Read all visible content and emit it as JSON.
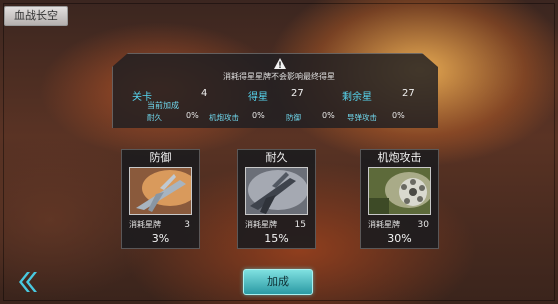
{
  "title_tab": "血战长空",
  "notice": "消耗得星星牌不会影响最终得星",
  "stats": [
    {
      "label": "关卡",
      "value": "4"
    },
    {
      "label": "得星",
      "value": "27"
    },
    {
      "label": "剩余星",
      "value": "27"
    }
  ],
  "current_bonus_label": "当前加成",
  "bonuses": [
    {
      "label": "耐久",
      "value": "0%"
    },
    {
      "label": "机炮攻击",
      "value": "0%"
    },
    {
      "label": "防御",
      "value": "0%"
    },
    {
      "label": "导弹攻击",
      "value": "0%"
    }
  ],
  "cards": [
    {
      "title": "防御",
      "cost_label": "消耗星牌",
      "cost": "3",
      "percent": "3%"
    },
    {
      "title": "耐久",
      "cost_label": "消耗星牌",
      "cost": "15",
      "percent": "15%"
    },
    {
      "title": "机炮攻击",
      "cost_label": "消耗星牌",
      "cost": "30",
      "percent": "30%"
    }
  ],
  "add_button": "加成",
  "icons": {
    "back": "back-chevron-icon",
    "warning": "warning-icon"
  },
  "colors": {
    "accent": "#57d6f0",
    "button": "#5cc8cc"
  }
}
